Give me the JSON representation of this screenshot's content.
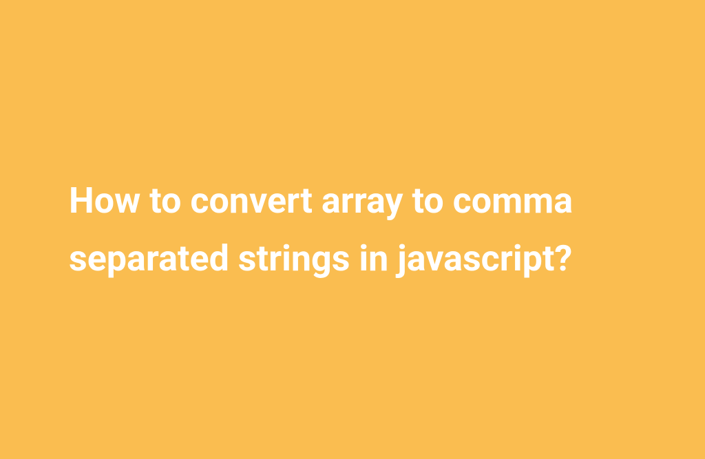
{
  "heading": "How to convert array to comma separated strings in javascript?",
  "colors": {
    "background": "#fabd50",
    "text": "#ffffff"
  }
}
